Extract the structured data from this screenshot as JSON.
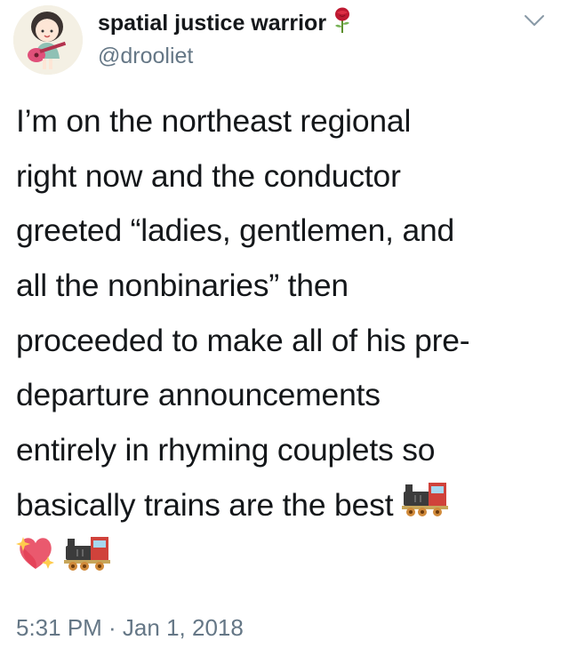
{
  "author": {
    "display_name": "spatial justice warrior",
    "handle": "@drooliet",
    "name_emoji": "rose-icon"
  },
  "tweet": {
    "lines": [
      "I’m on the northeast regional",
      "right now and the conductor",
      "greeted “ladies, gentlemen, and",
      "all the nonbinaries” then",
      "proceeded to make all of his pre-",
      "departure announcements",
      "entirely in rhyming couplets so",
      "basically trains are the best"
    ],
    "emojis": [
      "train-icon",
      "sparkling-heart-icon",
      "train-icon"
    ],
    "timestamp": "5:31 PM · Jan 1, 2018"
  },
  "menu": {
    "icon": "chevron-down-icon"
  }
}
